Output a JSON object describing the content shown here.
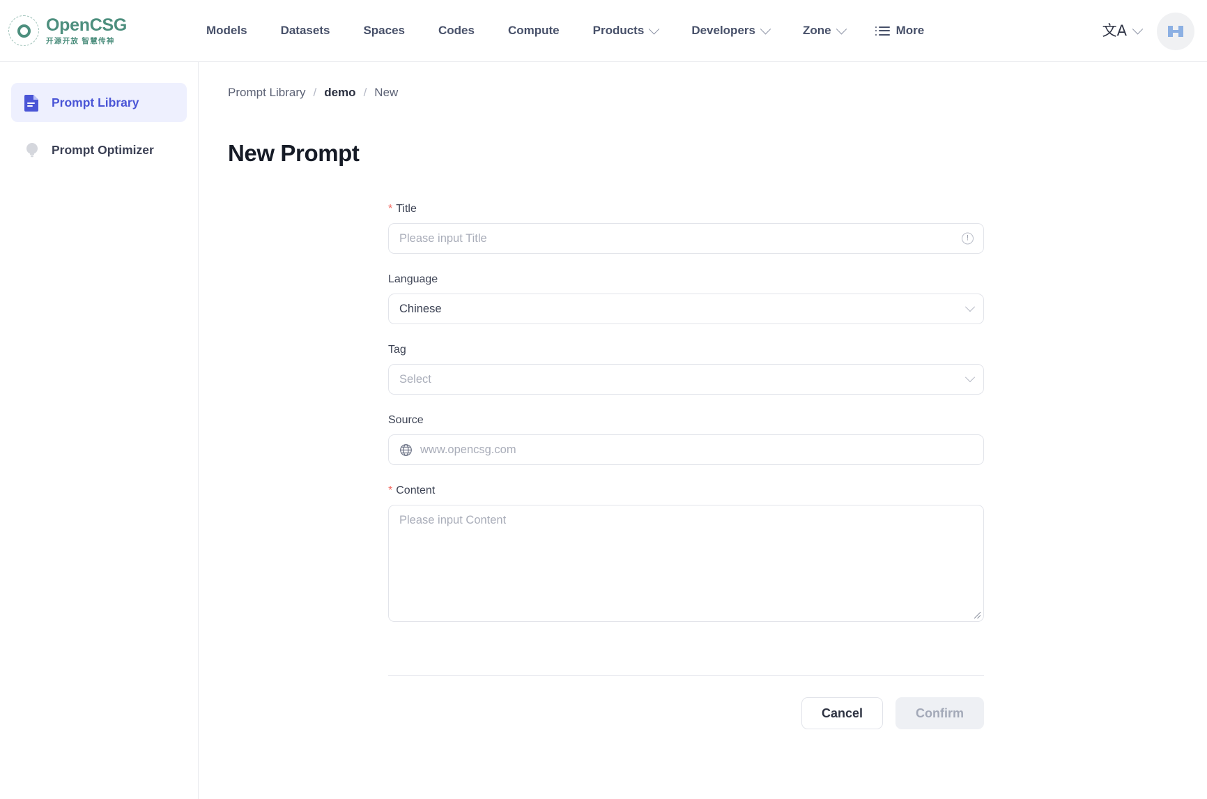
{
  "brand": {
    "name": "OpenCSG",
    "tagline": "开源开放 智慧传神",
    "logo_color": "#4d8f7e",
    "icon": "opencsg-logo-icon"
  },
  "topnav": {
    "items": [
      {
        "label": "Models",
        "has_caret": false
      },
      {
        "label": "Datasets",
        "has_caret": false
      },
      {
        "label": "Spaces",
        "has_caret": false
      },
      {
        "label": "Codes",
        "has_caret": false
      },
      {
        "label": "Compute",
        "has_caret": false
      },
      {
        "label": "Products",
        "has_caret": true
      },
      {
        "label": "Developers",
        "has_caret": true
      },
      {
        "label": "Zone",
        "has_caret": true
      }
    ],
    "more_label": "More",
    "more_icon": "list-icon",
    "language_icon": "translate-icon",
    "language_glyph": "文A",
    "avatar_icon": "user-avatar",
    "avatar_bg": "#f0f1f3",
    "avatar_glyph_color": "#8cb0e3"
  },
  "sidebar": {
    "items": [
      {
        "label": "Prompt Library",
        "icon": "document-icon",
        "active": true
      },
      {
        "label": "Prompt Optimizer",
        "icon": "lightbulb-icon",
        "active": false
      }
    ],
    "active_bg": "#eef0fe",
    "active_color": "#4a55d6"
  },
  "breadcrumb": {
    "root": "Prompt Library",
    "sep": "/",
    "middle": "demo",
    "current": "New"
  },
  "page": {
    "title": "New Prompt"
  },
  "form": {
    "required_mark": "*",
    "title_field": {
      "label": "Title",
      "placeholder": "Please input Title",
      "value": "",
      "required": true,
      "trailing_icon": "warning-circle-icon",
      "trailing_glyph": "!"
    },
    "language_field": {
      "label": "Language",
      "value": "Chinese",
      "required": false,
      "trailing_icon": "chevron-down-icon"
    },
    "tag_field": {
      "label": "Tag",
      "placeholder": "Select",
      "value": "",
      "required": false,
      "trailing_icon": "chevron-down-icon"
    },
    "source_field": {
      "label": "Source",
      "placeholder": "www.opencsg.com",
      "value": "",
      "required": false,
      "leading_icon": "globe-icon"
    },
    "content_field": {
      "label": "Content",
      "placeholder": "Please input Content",
      "value": "",
      "required": true,
      "resize_handle": "resize-grip-icon"
    }
  },
  "actions": {
    "cancel_label": "Cancel",
    "confirm_label": "Confirm",
    "confirm_disabled": true
  }
}
